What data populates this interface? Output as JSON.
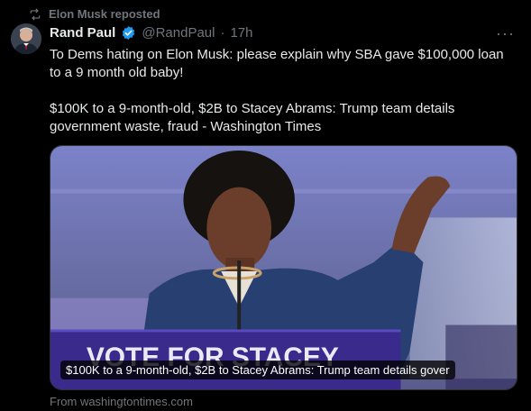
{
  "repost": {
    "icon": "repost-icon",
    "label": "Elon Musk reposted"
  },
  "author": {
    "name": "Rand Paul",
    "handle": "@RandPaul",
    "separator": "·",
    "time": "17h"
  },
  "more": {
    "label": "···"
  },
  "tweet": {
    "text": "To Dems hating on Elon Musk: please explain why SBA gave $100,000 loan to a 9 month old baby!",
    "link_title": "$100K to a 9-month-old, $2B to Stacey Abrams: Trump team details government waste, fraud - Washington Times"
  },
  "card": {
    "caption": "$100K to a 9-month-old, $2B to Stacey Abrams: Trump team details gover",
    "source": "From washingtontimes.com",
    "sign_text_top": "VOTE FOR STACEY",
    "sign_text_bottom": "STACEY"
  },
  "colors": {
    "background": "#000000",
    "text": "#e7e9ea",
    "muted": "#71767b",
    "verified": "#1d9bf0",
    "sign": "#3a2a8c"
  }
}
